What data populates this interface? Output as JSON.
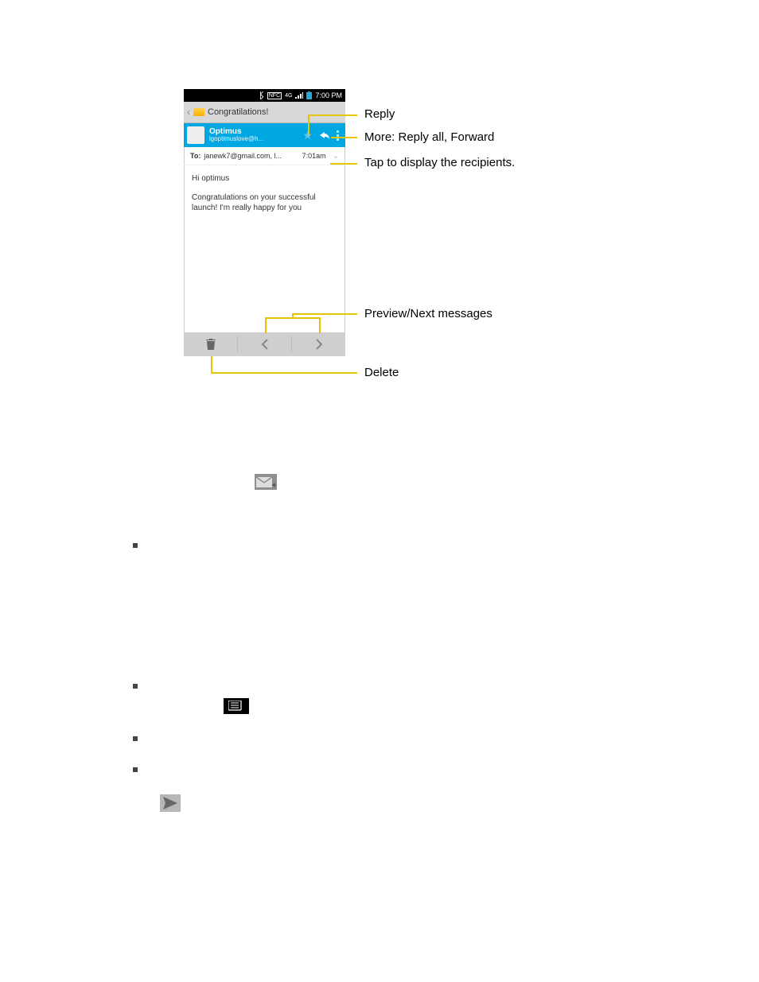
{
  "statusbar": {
    "time": "7:00 PM",
    "nfc": "NFC",
    "net": "4G"
  },
  "subject": "Congratilations!",
  "sender": {
    "name": "Optimus",
    "addr": "lgoptimuslove@h..."
  },
  "recipients": {
    "label": "To:",
    "list": "janewk7@gmail.com, l...",
    "time": "7:01am"
  },
  "body": {
    "greeting": "Hi optimus",
    "para": "Congratulations on your successful launch! I'm really happy for you"
  },
  "callouts": {
    "reply": "Reply",
    "more": "More: Reply all, Forward",
    "recipients": "Tap to display the recipients.",
    "prevnext": "Preview/Next messages",
    "delete": "Delete"
  },
  "chart_data": null
}
